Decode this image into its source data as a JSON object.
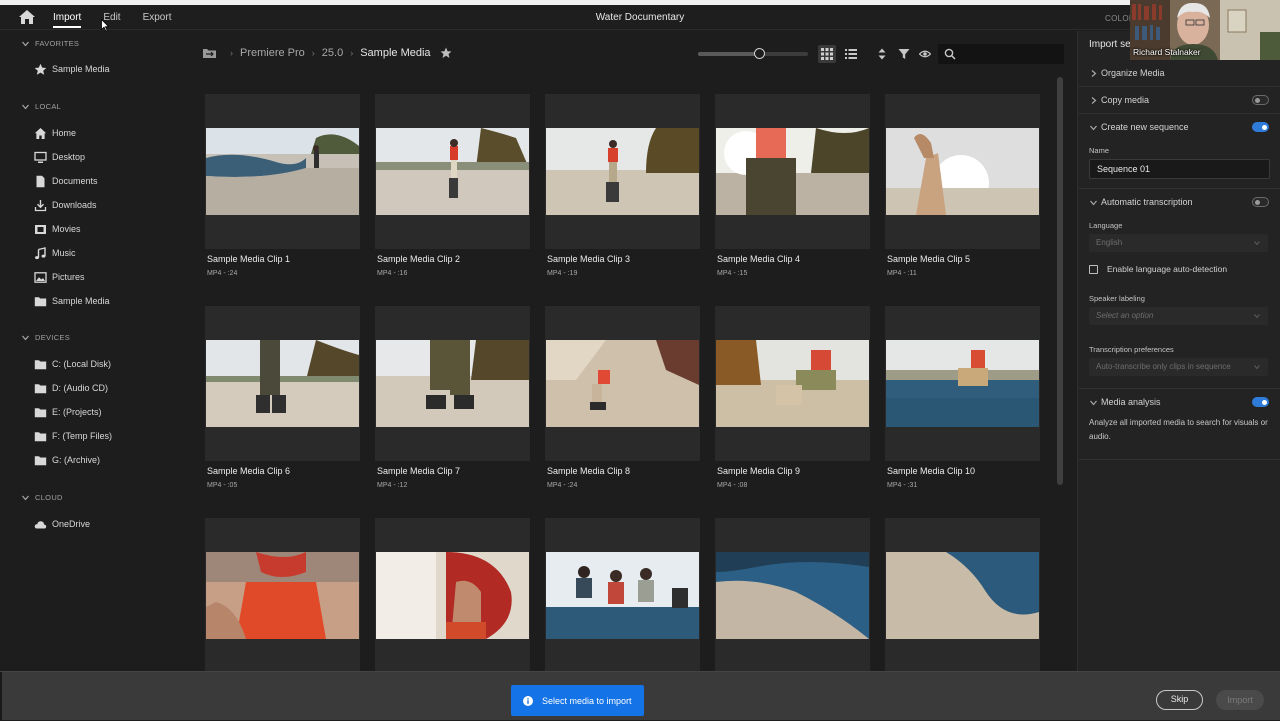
{
  "app": {
    "title": "Water Documentary",
    "nav_tabs": [
      {
        "label": "Import",
        "active": true
      },
      {
        "label": "Edit",
        "active": false
      },
      {
        "label": "Export",
        "active": false
      }
    ],
    "top_right_label": "COLOR",
    "home_icon": "home-icon"
  },
  "sidebar": {
    "favorites_header": "FAVORITES",
    "favorites": [
      {
        "label": "Sample Media",
        "icon": "star-icon"
      }
    ],
    "local_header": "LOCAL",
    "local": [
      {
        "label": "Home",
        "icon": "home-icon"
      },
      {
        "label": "Desktop",
        "icon": "monitor-icon"
      },
      {
        "label": "Documents",
        "icon": "document-icon"
      },
      {
        "label": "Downloads",
        "icon": "download-icon"
      },
      {
        "label": "Movies",
        "icon": "film-icon"
      },
      {
        "label": "Music",
        "icon": "music-note-icon"
      },
      {
        "label": "Pictures",
        "icon": "image-icon"
      },
      {
        "label": "Sample Media",
        "icon": "folder-icon"
      }
    ],
    "devices_header": "DEVICES",
    "devices": [
      {
        "label": "C: (Local Disk)",
        "icon": "folder-icon"
      },
      {
        "label": "D: (Audio CD)",
        "icon": "folder-icon"
      },
      {
        "label": "E: (Projects)",
        "icon": "folder-icon"
      },
      {
        "label": "F: (Temp Files)",
        "icon": "folder-icon"
      },
      {
        "label": "G: (Archive)",
        "icon": "folder-icon"
      }
    ],
    "cloud_header": "CLOUD",
    "cloud": [
      {
        "label": "OneDrive",
        "icon": "cloud-icon"
      }
    ]
  },
  "browser": {
    "breadcrumb": [
      "Premiere Pro",
      "25.0",
      "Sample Media"
    ],
    "zoom_level": 0.55,
    "search_placeholder": "",
    "clips": [
      {
        "name": "Sample Media Clip 1",
        "meta": "MP4 - :24"
      },
      {
        "name": "Sample Media Clip 2",
        "meta": "MP4 - :16"
      },
      {
        "name": "Sample Media Clip 3",
        "meta": "MP4 - :19"
      },
      {
        "name": "Sample Media Clip 4",
        "meta": "MP4 - :15"
      },
      {
        "name": "Sample Media Clip 5",
        "meta": "MP4 - :11"
      },
      {
        "name": "Sample Media Clip 6",
        "meta": "MP4 - :05"
      },
      {
        "name": "Sample Media Clip 7",
        "meta": "MP4 - :12"
      },
      {
        "name": "Sample Media Clip 8",
        "meta": "MP4 - :24"
      },
      {
        "name": "Sample Media Clip 9",
        "meta": "MP4 - :08"
      },
      {
        "name": "Sample Media Clip 10",
        "meta": "MP4 - :31"
      },
      {
        "name": "",
        "meta": ""
      },
      {
        "name": "",
        "meta": ""
      },
      {
        "name": "",
        "meta": ""
      },
      {
        "name": "",
        "meta": ""
      },
      {
        "name": "",
        "meta": ""
      }
    ]
  },
  "settings": {
    "title": "Import se",
    "organize_media": "Organize Media",
    "copy_media": "Copy media",
    "copy_media_on": false,
    "create_sequence": "Create new sequence",
    "create_sequence_on": true,
    "name_label": "Name",
    "sequence_name": "Sequence 01",
    "auto_transcription": "Automatic transcription",
    "auto_transcription_on": false,
    "language_label": "Language",
    "language_value": "English",
    "auto_detect_label": "Enable language auto-detection",
    "speaker_label": "Speaker labeling",
    "speaker_value": "Select an option",
    "transcription_prefs_label": "Transcription preferences",
    "transcription_prefs_value": "Auto-transcribe only clips in sequence",
    "media_analysis": "Media analysis",
    "media_analysis_on": true,
    "media_analysis_desc": "Analyze all imported media to search for visuals or audio."
  },
  "webcam": {
    "name": "Richard Stalnaker"
  },
  "footer": {
    "notice": "Select media to import",
    "skip_label": "Skip",
    "import_label": "Import"
  },
  "colors": {
    "accent": "#1473e6",
    "toggle_on": "#2f7bda"
  }
}
